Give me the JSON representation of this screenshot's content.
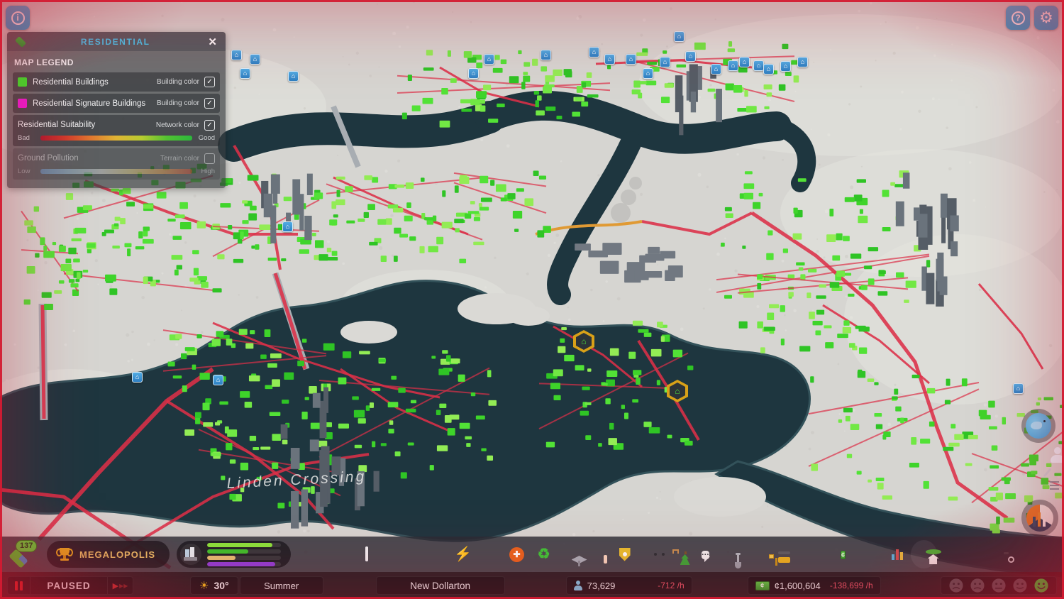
{
  "icons": {
    "info": "i",
    "help": "?",
    "gear": "⚙",
    "close": "✕",
    "check": "✓",
    "house": "⌂",
    "recycle": "♻",
    "bolt": "⚡",
    "sun": "☀",
    "cent": "¢",
    "bubble_dots": "···",
    "play": "▶",
    "play_fast": "▶▶"
  },
  "legend": {
    "title": "RESIDENTIAL",
    "section": "MAP LEGEND",
    "rows": [
      {
        "label": "Residential Buildings",
        "type": "Building color",
        "swatch": "#3be62c",
        "checked": true
      },
      {
        "label": "Residential Signature Buildings",
        "type": "Building color",
        "swatch": "#ee1ed4",
        "checked": true
      },
      {
        "label": "Residential Suitability",
        "type": "Network color",
        "checked": true,
        "low": "Bad",
        "high": "Good",
        "gradient": "linear-gradient(90deg,#b01c2e,#d23c2c,#e07830,#e0b434,#b8cc30,#52c232,#2cb83c)"
      },
      {
        "label": "Ground Pollution",
        "type": "Terrain color",
        "checked": false,
        "low": "Low",
        "high": "High",
        "gradient": "linear-gradient(90deg,#5a9cd8,#9cc3dc,#d8d8d4,#dcc87a,#d89040,#c23824)"
      }
    ]
  },
  "map": {
    "label": "Linden Crossing"
  },
  "toolbar": {
    "level": "137",
    "milestone": "MEGALOPOLIS",
    "progress": [
      {
        "color": "#8ae63c",
        "pct": 88
      },
      {
        "color": "#3dc32c",
        "pct": 56
      },
      {
        "color": "#e6c276",
        "pct": 38
      },
      {
        "color": "#9040d8",
        "pct": 92
      }
    ],
    "tools": [
      {
        "name": "zoning-tool",
        "icon": "zoning"
      },
      {
        "name": "districts-tool",
        "icon": "districts"
      },
      {
        "name": "terrain-tool",
        "icon": "terrain"
      },
      {
        "name": "roads-tool",
        "icon": "roads"
      },
      {
        "name": "electricity-tool",
        "icon": "electricity"
      },
      {
        "name": "water-sewage-tool",
        "icon": "water"
      },
      {
        "name": "healthcare-tool",
        "icon": "healthcare"
      },
      {
        "name": "garbage-tool",
        "icon": "garbage"
      },
      {
        "name": "education-tool",
        "icon": "education"
      },
      {
        "name": "fire-rescue-tool",
        "icon": "fire"
      },
      {
        "name": "police-tool",
        "icon": "police"
      },
      {
        "name": "transportation-tool",
        "icon": "transport"
      },
      {
        "name": "parks-recreation-tool",
        "icon": "parks"
      },
      {
        "name": "communications-tool",
        "icon": "communications"
      },
      {
        "name": "landscaping-tool",
        "icon": "shovel"
      },
      {
        "name": "bulldozer-tool",
        "icon": "bulldozer"
      },
      {
        "name": "economy-button",
        "icon": "economy"
      },
      {
        "name": "info-views-button",
        "icon": "infoviews"
      },
      {
        "name": "statistics-button",
        "icon": "statistics"
      },
      {
        "name": "progression-button",
        "icon": "progression"
      },
      {
        "name": "photo-mode-button",
        "icon": "camera"
      }
    ]
  },
  "status": {
    "paused": "PAUSED",
    "temperature": "30°",
    "season": "Summer",
    "city_name": "New Dollarton",
    "population": "73,629",
    "population_rate": "-712 /h",
    "money": "¢1,600,604",
    "money_rate": "-138,699 /h",
    "faces": [
      {
        "mood": "very-sad",
        "active": false
      },
      {
        "mood": "sad",
        "active": false
      },
      {
        "mood": "neutral",
        "active": false
      },
      {
        "mood": "content",
        "active": false
      },
      {
        "mood": "happy",
        "active": true
      }
    ]
  },
  "colors": {
    "accent_cyan": "#3dbde8",
    "residential_green": "#3be62c",
    "signature_magenta": "#ee1ed4",
    "bad_road_red": "#dc3048",
    "negative_rate": "#e8596b",
    "happy_green": "#2ee03c",
    "pause_red": "#d31a32"
  }
}
